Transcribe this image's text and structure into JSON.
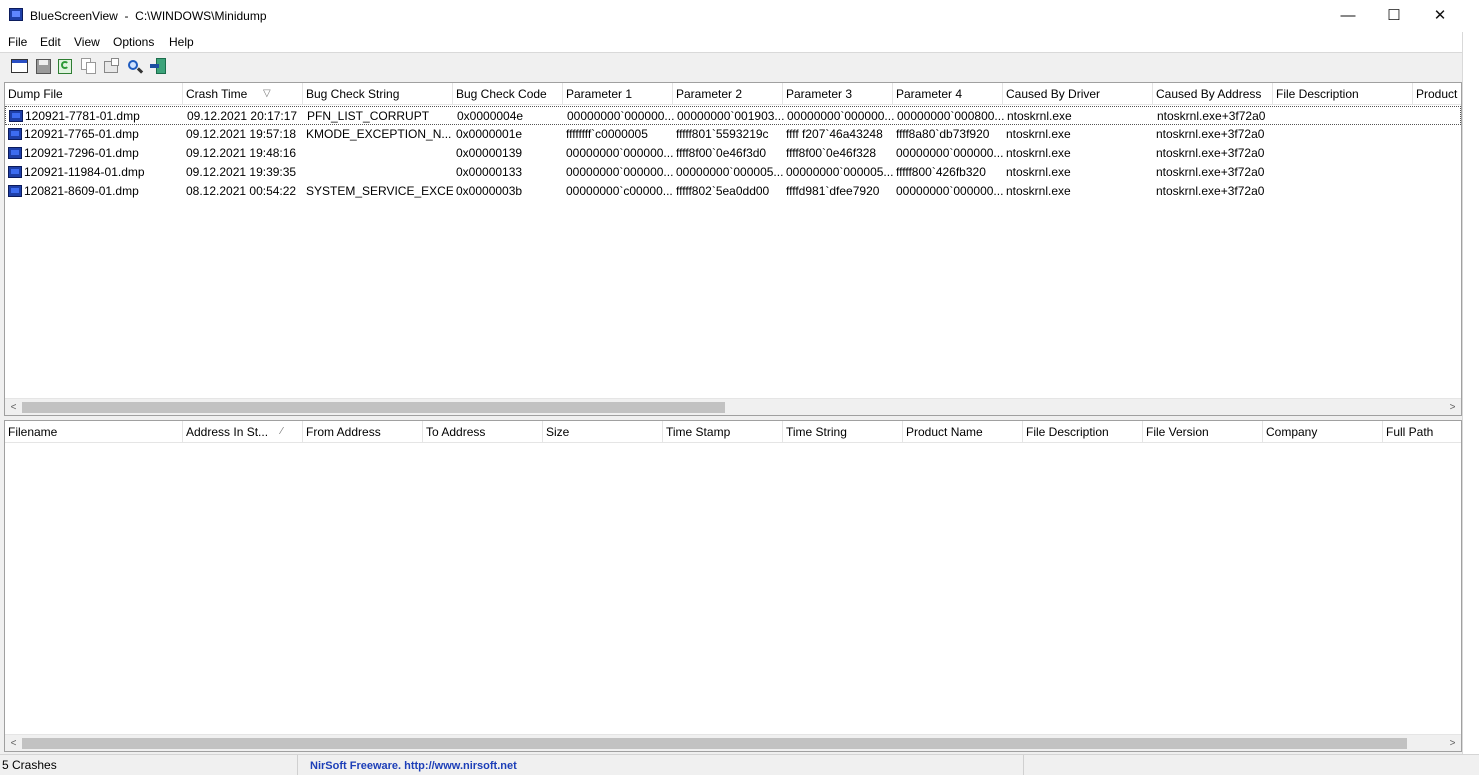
{
  "window": {
    "title": "BlueScreenView  -  C:\\WINDOWS\\Minidump",
    "minimize": "—",
    "maximize": "☐",
    "close": "✕"
  },
  "menu": [
    "File",
    "Edit",
    "View",
    "Options",
    "Help"
  ],
  "toolbar": {
    "buttons": [
      "properties-icon",
      "save-icon",
      "refresh-icon",
      "copy-icon",
      "html-report-icon",
      "find-icon",
      "exit-icon"
    ]
  },
  "crash_list": {
    "columns": [
      "Dump File",
      "Crash Time",
      "Bug Check String",
      "Bug Check Code",
      "Parameter 1",
      "Parameter 2",
      "Parameter 3",
      "Parameter 4",
      "Caused By Driver",
      "Caused By Address",
      "File Description",
      "Product"
    ],
    "sort_indicator": "▽",
    "rows": [
      [
        "120921-7781-01.dmp",
        "09.12.2021 20:17:17",
        "PFN_LIST_CORRUPT",
        "0x0000004e",
        "00000000`000000...",
        "00000000`001903...",
        "00000000`000000...",
        "00000000`000800...",
        "ntoskrnl.exe",
        "ntoskrnl.exe+3f72a0"
      ],
      [
        "120921-7765-01.dmp",
        "09.12.2021 19:57:18",
        "KMODE_EXCEPTION_N...",
        "0x0000001e",
        "ffffffff`c0000005",
        "fffff801`5593219c",
        "ffff f207`46a43248",
        "ffff8a80`db73f920",
        "ntoskrnl.exe",
        "ntoskrnl.exe+3f72a0"
      ],
      [
        "120921-7296-01.dmp",
        "09.12.2021 19:48:16",
        "",
        "0x00000139",
        "00000000`000000...",
        "ffff8f00`0e46f3d0",
        "ffff8f00`0e46f328",
        "00000000`000000...",
        "ntoskrnl.exe",
        "ntoskrnl.exe+3f72a0"
      ],
      [
        "120921-11984-01.dmp",
        "09.12.2021 19:39:35",
        "",
        "0x00000133",
        "00000000`000000...",
        "00000000`000005...",
        "00000000`000005...",
        "fffff800`426fb320",
        "ntoskrnl.exe",
        "ntoskrnl.exe+3f72a0"
      ],
      [
        "120821-8609-01.dmp",
        "08.12.2021 00:54:22",
        "SYSTEM_SERVICE_EXCEP...",
        "0x0000003b",
        "00000000`c00000...",
        "fffff802`5ea0dd00",
        "ffffd981`dfee7920",
        "00000000`000000...",
        "ntoskrnl.exe",
        "ntoskrnl.exe+3f72a0"
      ]
    ]
  },
  "driver_list": {
    "columns": [
      "Filename",
      "Address In St...",
      "From Address",
      "To Address",
      "Size",
      "Time Stamp",
      "Time String",
      "Product Name",
      "File Description",
      "File Version",
      "Company",
      "Full Path"
    ],
    "sort_indicator": "⁄"
  },
  "scroll": {
    "left": "<",
    "right": ">"
  },
  "status": {
    "count": "5 Crashes",
    "freeware": "NirSoft Freeware.  http://www.nirsoft.net"
  }
}
